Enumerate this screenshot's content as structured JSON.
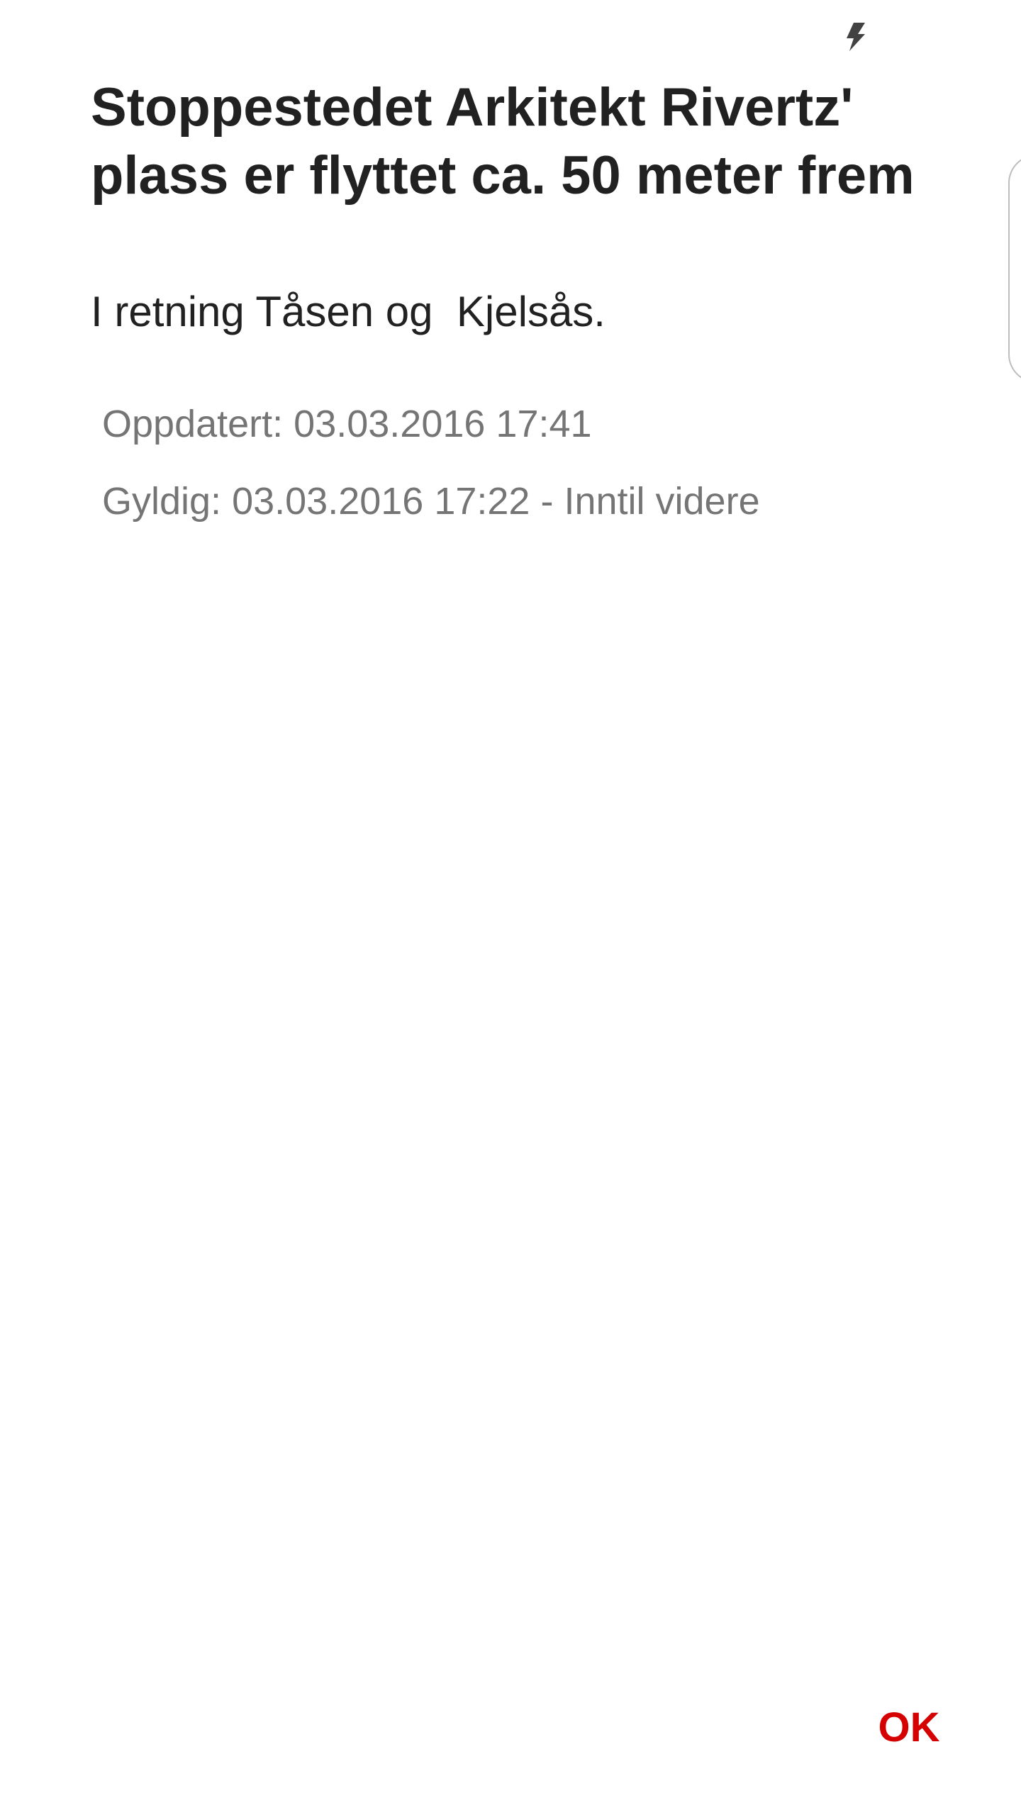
{
  "status_bar": {
    "icon": "flash-icon"
  },
  "dialog": {
    "title": "Stoppestedet Arkitekt Rivertz' plass er flyttet ca. 50 meter frem",
    "message": "I retning Tåsen og  Kjelsås.",
    "updated": "Oppdatert: 03.03.2016 17:41",
    "valid": "Gyldig: 03.03.2016 17:22 - Inntil videre",
    "ok_label": "OK",
    "accent_color": "#d50000"
  }
}
